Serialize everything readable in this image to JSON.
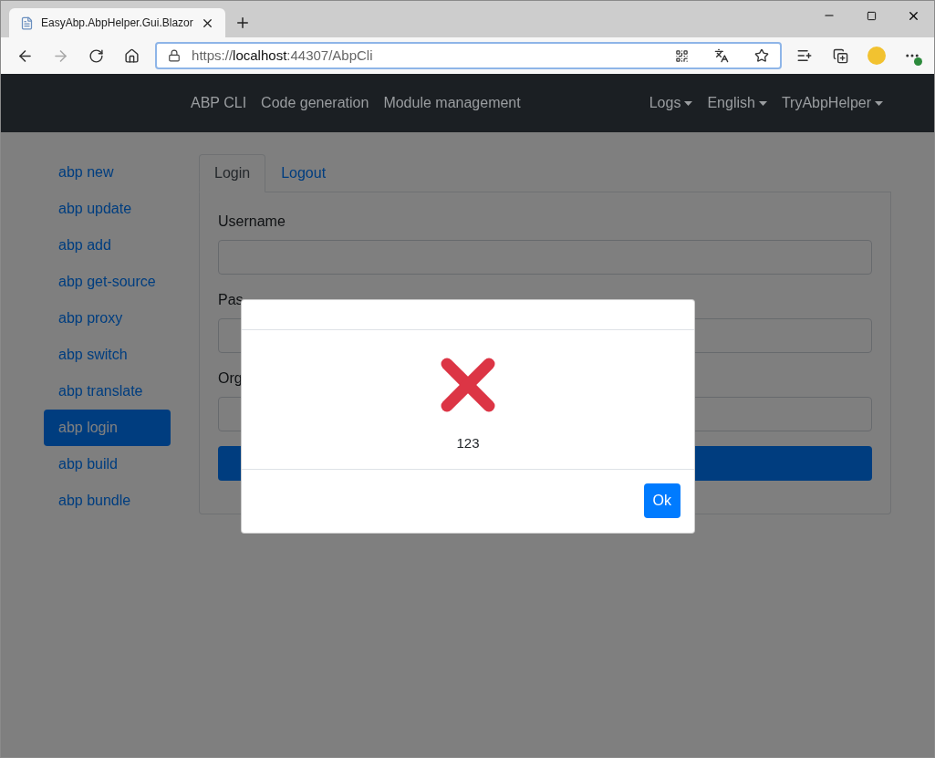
{
  "browser": {
    "tab_title": "EasyAbp.AbpHelper.Gui.Blazor",
    "url": {
      "scheme": "https://",
      "host": "localhost",
      "rest": ":44307/AbpCli"
    }
  },
  "navbar": {
    "links": [
      "ABP CLI",
      "Code generation",
      "Module management"
    ],
    "dropdowns": [
      "Logs",
      "English",
      "TryAbpHelper"
    ]
  },
  "sidebar": {
    "items": [
      {
        "label": "abp new",
        "selected": false
      },
      {
        "label": "abp update",
        "selected": false
      },
      {
        "label": "abp add",
        "selected": false
      },
      {
        "label": "abp get-source",
        "selected": false
      },
      {
        "label": "abp proxy",
        "selected": false
      },
      {
        "label": "abp switch",
        "selected": false
      },
      {
        "label": "abp translate",
        "selected": false
      },
      {
        "label": "abp login",
        "selected": true
      },
      {
        "label": "abp build",
        "selected": false
      },
      {
        "label": "abp bundle",
        "selected": false
      }
    ]
  },
  "tabs": [
    {
      "label": "Login",
      "selected": true
    },
    {
      "label": "Logout",
      "selected": false
    }
  ],
  "form": {
    "fields": [
      {
        "label": "Username"
      },
      {
        "label": "Pas"
      },
      {
        "label": "Org"
      }
    ]
  },
  "modal": {
    "kind": "error",
    "message": "123",
    "button": "Ok"
  }
}
